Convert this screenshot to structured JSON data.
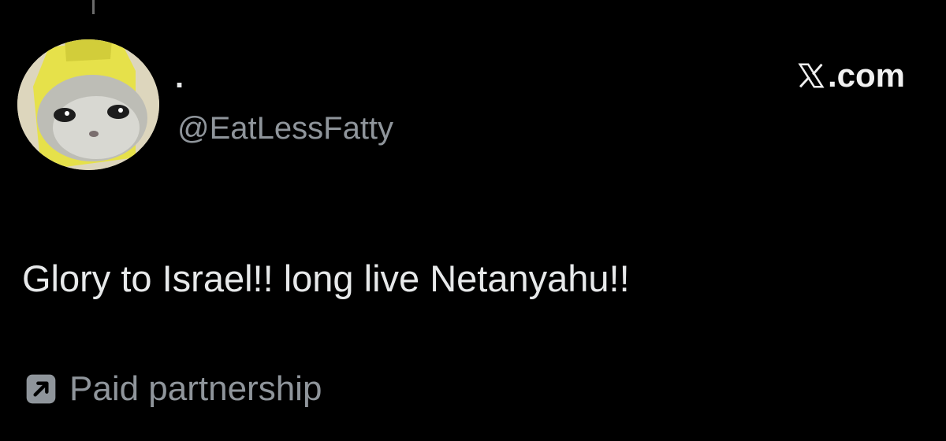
{
  "tweet": {
    "display_name": ".",
    "handle": "@EatLessFatty",
    "text": "Glory to Israel!! long live Netanyahu!!"
  },
  "brand": {
    "label": ".com",
    "icon": "x-logo-icon"
  },
  "footer": {
    "paid_label": "Paid partnership",
    "icon": "arrow-up-right-icon"
  },
  "colors": {
    "background": "#000000",
    "primary_text": "#e7e9ea",
    "secondary_text": "#8f959b",
    "thread_line": "#6b6b6b"
  }
}
